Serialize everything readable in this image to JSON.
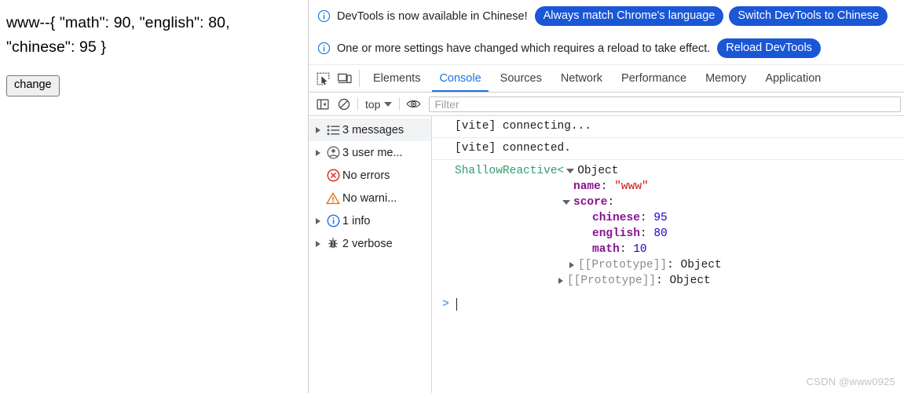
{
  "page": {
    "output_text": "www--{ \"math\": 90, \"english\": 80, \"chinese\": 95 }",
    "change_button": "change"
  },
  "banners": [
    {
      "icon": "info-circle-icon",
      "text": "DevTools is now available in Chinese!",
      "buttons": [
        "Always match Chrome's language",
        "Switch DevTools to Chinese"
      ]
    },
    {
      "icon": "info-circle-icon",
      "text": "One or more settings have changed which requires a reload to take effect.",
      "buttons": [
        "Reload DevTools"
      ]
    }
  ],
  "tabstrip": {
    "icons": [
      "inspect-element-icon",
      "device-toolbar-icon"
    ],
    "tabs": [
      {
        "label": "Elements",
        "active": false
      },
      {
        "label": "Console",
        "active": true
      },
      {
        "label": "Sources",
        "active": false
      },
      {
        "label": "Network",
        "active": false
      },
      {
        "label": "Performance",
        "active": false
      },
      {
        "label": "Memory",
        "active": false
      },
      {
        "label": "Application",
        "active": false
      }
    ]
  },
  "console_toolbar": {
    "sidebar_toggle_icon": "show-console-sidebar-icon",
    "clear_icon": "clear-console-icon",
    "context_selector": "top",
    "eye_icon": "create-live-expression-icon",
    "filter_placeholder": "Filter",
    "filter_value": ""
  },
  "console_sidebar": [
    {
      "label": "3 messages",
      "icon": "list-icon",
      "expandable": true,
      "selected": true
    },
    {
      "label": "3 user me...",
      "icon": "user-message-icon",
      "expandable": true,
      "selected": false
    },
    {
      "label": "No errors",
      "icon": "error-icon",
      "expandable": false,
      "selected": false
    },
    {
      "label": "No warni...",
      "icon": "warning-icon",
      "expandable": false,
      "selected": false
    },
    {
      "label": "1 info",
      "icon": "info-icon",
      "expandable": true,
      "selected": false
    },
    {
      "label": "2 verbose",
      "icon": "verbose-bug-icon",
      "expandable": true,
      "selected": false
    }
  ],
  "console_messages": [
    {
      "type": "log",
      "text": "[vite] connecting..."
    },
    {
      "type": "log",
      "text": "[vite] connected."
    }
  ],
  "console_object": {
    "wrapper_label": "ShallowReactive<",
    "type_label": "Object",
    "close_bracket": ">",
    "properties": [
      {
        "name": "name",
        "colon": ":",
        "value": "\"www\"",
        "value_type": "string"
      }
    ],
    "score": {
      "name": "score",
      "colon": ":",
      "properties": [
        {
          "name": "chinese",
          "colon": ":",
          "value": "95",
          "value_type": "number"
        },
        {
          "name": "english",
          "colon": ":",
          "value": "80",
          "value_type": "number"
        },
        {
          "name": "math",
          "colon": ":",
          "value": "10",
          "value_type": "number"
        }
      ],
      "prototype_label": "[[Prototype]]",
      "prototype_value": ": Object"
    },
    "prototype_label": "[[Prototype]]",
    "prototype_value": ": Object"
  },
  "console_prompt": {
    "arrow": ">",
    "input_value": ""
  },
  "watermark": "CSDN @www0925",
  "colors": {
    "accent_blue": "#1a73e8",
    "pill_blue": "#1a56d6",
    "property_magenta": "#881391",
    "string_red": "#c41a16",
    "number_blue": "#1c00cf",
    "shallow_green": "#2f9e6c",
    "error_red": "#d93025",
    "warning_orange": "#e8710a",
    "info_blue": "#1a73e8",
    "prototype_gray": "#8c8c8c"
  }
}
